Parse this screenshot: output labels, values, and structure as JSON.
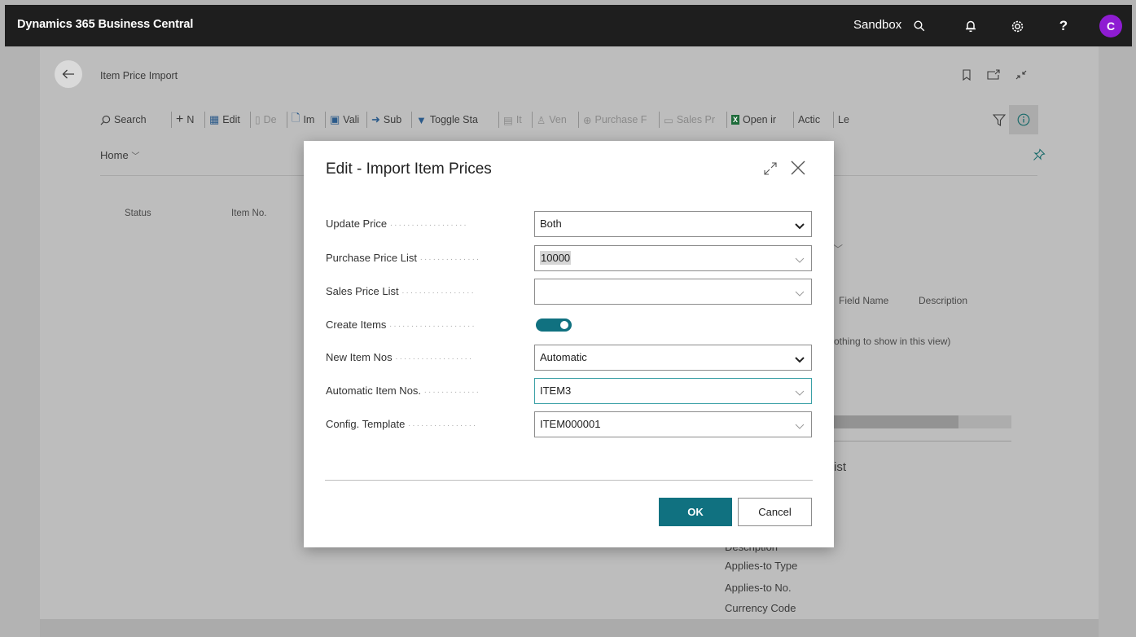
{
  "topbar": {
    "app_title": "Dynamics 365 Business Central",
    "environment": "Sandbox",
    "avatar_initial": "C",
    "avatar_color": "#8e1cd2"
  },
  "page": {
    "title": "Item Price Import",
    "actions": [
      {
        "label": "Search",
        "icon": "search-icon"
      },
      {
        "label": "N",
        "icon": "plus-icon"
      },
      {
        "label": "Edit",
        "icon": "edit-list-icon"
      },
      {
        "label": "De",
        "icon": "delete-icon"
      },
      {
        "label": "Im",
        "icon": "import-icon"
      },
      {
        "label": "Vali",
        "icon": "validate-icon"
      },
      {
        "label": "Sub",
        "icon": "submit-icon"
      },
      {
        "label": "Toggle Sta",
        "icon": "filter-icon"
      },
      {
        "label": "It",
        "icon": "item-icon"
      },
      {
        "label": "Ven",
        "icon": "vendor-icon"
      },
      {
        "label": "Purchase F",
        "icon": "purchase-icon"
      },
      {
        "label": "Sales Pr",
        "icon": "sales-icon"
      },
      {
        "label": "Open ir",
        "icon": "excel-icon"
      },
      {
        "label": "Actic",
        "icon": ""
      },
      {
        "label": "Le",
        "icon": ""
      }
    ],
    "home_tab": "Home",
    "columns": [
      "Status",
      "Item No."
    ],
    "factbox_dropdown_hint": "",
    "factbox_columns": [
      "Field Name",
      "Description"
    ],
    "factbox_empty": "othing to show in this view)",
    "factbox_progress": 0.7,
    "factbox_section": "ist",
    "factbox_fields": [
      "Description",
      "Applies-to Type",
      "Applies-to No.",
      "Currency Code"
    ]
  },
  "dialog": {
    "title": "Edit - Import Item Prices",
    "fields": [
      {
        "label": "Update Price",
        "value": "Both",
        "type": "select"
      },
      {
        "label": "Purchase Price List",
        "value": "10000",
        "type": "lookup"
      },
      {
        "label": "Sales Price List",
        "value": "",
        "type": "lookup"
      },
      {
        "label": "Create Items",
        "value": "on",
        "type": "toggle"
      },
      {
        "label": "New Item Nos",
        "value": "Automatic",
        "type": "select"
      },
      {
        "label": "Automatic Item Nos.",
        "value": "ITEM3",
        "type": "lookup"
      },
      {
        "label": "Config. Template",
        "value": "ITEM000001",
        "type": "lookup"
      }
    ],
    "ok_label": "OK",
    "cancel_label": "Cancel",
    "accent_color": "#107180"
  }
}
